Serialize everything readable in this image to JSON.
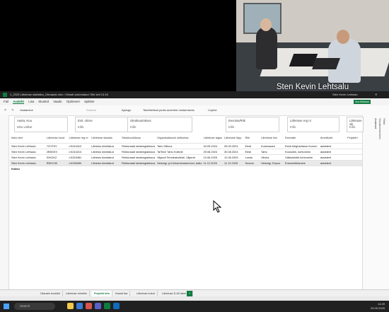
{
  "video": {
    "participant_name": "Sten Kevin Lehtsalu"
  },
  "excel": {
    "title": "1_2025 Lähetuse statistika_Ülevaade.xlsx • Viimati salvestatud: Eile kell 13:18",
    "user": "Sten Kevin Lehtsalu",
    "menu": [
      "Fail",
      "Avaleht",
      "Lisa",
      "Mustrid",
      "Vaade",
      "Optimeeri",
      "Spikker"
    ],
    "menu_active": "Avaleht",
    "share_label": "Ava töölaual",
    "toolbar": {
      "undo": "↶",
      "redo": "↷",
      "view": "Vaatamine",
      "filter": "Sorteeri",
      "history": "Ajalugu",
      "copilot": "Copilot",
      "insert": "Sisesta",
      "assist": "Tabelbelised jaotis andmete eristamiseks"
    },
    "right_pane": {
      "title": "Andmed",
      "items": [
        "Visualiseerimised",
        "Filtrid"
      ]
    },
    "filters": [
      {
        "label": "Aasta, Kuu",
        "value": "Mitu valikut"
      },
      {
        "label": "Esit. olicne",
        "value": "Kõik"
      },
      {
        "label": "Struktuuriüksus",
        "value": "Kõik"
      },
      {
        "label": "Eesotsa/Riik",
        "value": "Kõik"
      },
      {
        "label": "Lähetuse reg nr",
        "value": "Kõik"
      },
      {
        "label": "Lähetuse sik",
        "value": "Kõik"
      }
    ],
    "table": {
      "headers": [
        "Isiku nimi",
        "Lähetuse kood",
        "Lähetuse reg nr",
        "Lähetuse staatus",
        "Struktuuriüksus",
        "Organisatsiooni sihtkohas",
        "Lähetuse algus",
        "Lähetuse lõpp",
        "Riik",
        "Lähetuse linn",
        "Eesmärk",
        "Ametikoht",
        "Projekti t"
      ],
      "rows": [
        [
          "Sten Kevin Lehtsalu",
          "7GYF3Y",
          "LK244412",
          "Lähetus kinnitatud",
          "Rektoraadi strateegiaüksus",
          "Tartu Ülikool",
          "04.09.2024",
          "05.09.2024",
          "Eesti",
          "Kuressaare",
          "Eesti kõrghariduse foorum",
          "assistent",
          ""
        ],
        [
          "Sten Kevin Lehtsalu",
          "2BSDEX",
          "LK244213",
          "Lähetus kinnitatud",
          "Rektoraadi strateegiaüksus",
          "TalTech Tartu Kolledž",
          "29.08.2024",
          "30.08.2024",
          "Eesti",
          "Tartu",
          "Koosolek, kohtumine",
          "assistent",
          ""
        ],
        [
          "Sten Kevin Lehtsalu",
          "5XK2KZ",
          "LK253481",
          "Lähetus kinnitatud",
          "Rektoraadi strateegiaüksus",
          "Viljandi Tehnikakolledž, Viljandi",
          "10.06.2025",
          "12.06.2025",
          "Leedu",
          "Vilnius",
          "Välisvisiidid kohtumine",
          "assistent",
          ""
        ],
        [
          "Sten Kevin Lehtsalu",
          "REKC50",
          "LK256050",
          "Lähetus kinnitatud",
          "Rektoraadi strateegiaüksus",
          "Helsingi- ja Kehamünsteeriumi, Aalto Ülikool",
          "11.12.2025",
          "11.12.2025",
          "Soome",
          "Helsingi, Espoo",
          "Eneseetšitamine",
          "assistent",
          ""
        ]
      ],
      "total_label": "Kokku"
    },
    "sheet_tabs": [
      "Üksuste koostöö",
      "Lähetuse reimbiis",
      "Projekti info",
      "Kaardi faa",
      "Lähetuse kulud",
      "Lähetuse D-60 tabel"
    ],
    "active_tab": "Projekti info"
  },
  "taskbar": {
    "search_placeholder": "Search",
    "time": "14:49",
    "date": "29.09.2025"
  },
  "colors": {
    "excel_green": "#107c41",
    "taskbar": "#202020"
  }
}
